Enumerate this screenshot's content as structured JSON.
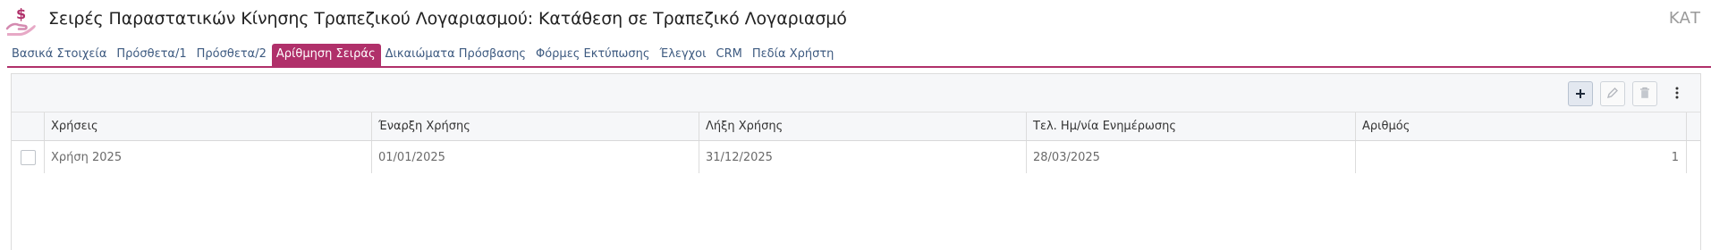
{
  "header": {
    "title": "Σειρές Παραστατικών Κίνησης Τραπεζικού Λογαριασμού: Κατάθεση σε Τραπεζικό Λογαριασμό",
    "mode": "ΚΑΤ",
    "icon": "money-hand-icon",
    "accent": "#b0306a"
  },
  "tabs": [
    {
      "label": "Βασικά Στοιχεία"
    },
    {
      "label": "Πρόσθετα/1"
    },
    {
      "label": "Πρόσθετα/2"
    },
    {
      "label": "Αρίθμηση Σειράς",
      "active": true
    },
    {
      "label": "Δικαιώματα Πρόσβασης"
    },
    {
      "label": "Φόρμες Εκτύπωσης"
    },
    {
      "label": "Έλεγχοι"
    },
    {
      "label": "CRM"
    },
    {
      "label": "Πεδία Χρήστη"
    }
  ],
  "toolbar": {
    "add_icon": "plus-icon",
    "edit_icon": "pencil-icon",
    "delete_icon": "trash-icon",
    "more_icon": "vertical-dots-icon"
  },
  "grid": {
    "columns": [
      "Χρήσεις",
      "Έναρξη Χρήσης",
      "Λήξη Χρήσης",
      "Τελ. Ημ/νία Ενημέρωσης",
      "Αριθμός"
    ],
    "rows": [
      {
        "checked": false,
        "cells": [
          "Χρήση 2025",
          "01/01/2025",
          "31/12/2025",
          "28/03/2025",
          "1"
        ]
      }
    ]
  }
}
